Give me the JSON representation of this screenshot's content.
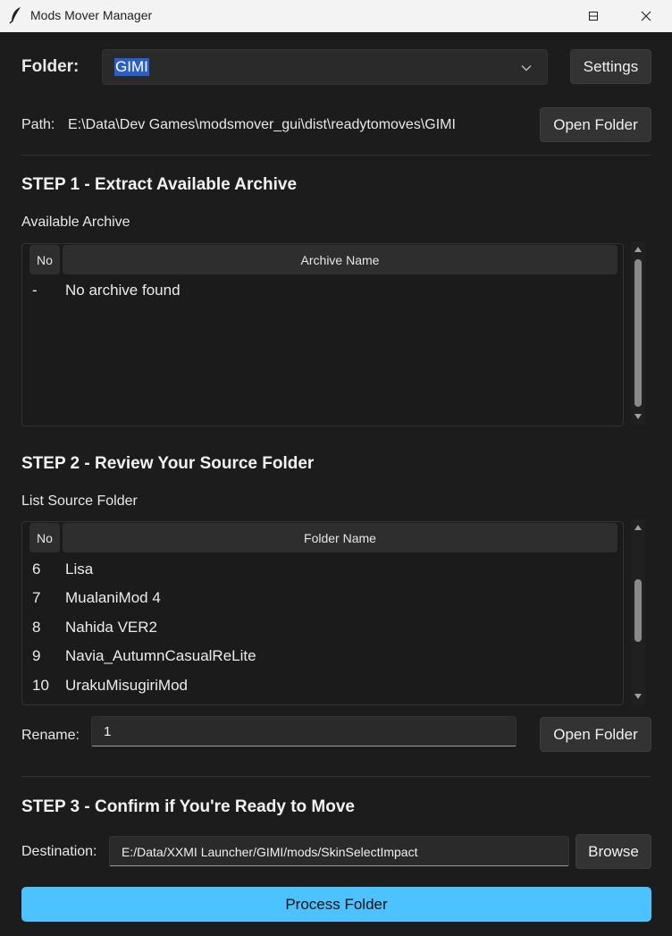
{
  "window": {
    "title": "Mods Mover Manager"
  },
  "folder": {
    "label": "Folder:",
    "selected": "GIMI",
    "settings_label": "Settings"
  },
  "path": {
    "label": "Path:",
    "value": "E:\\Data\\Dev Games\\modsmover_gui\\dist\\readytomoves\\GIMI",
    "open_label": "Open Folder"
  },
  "step1": {
    "title": "STEP 1 - Extract Available Archive",
    "list_label": "Available Archive",
    "columns": [
      "No",
      "Archive Name"
    ],
    "rows": [
      {
        "no": "-",
        "name": "No archive found"
      }
    ]
  },
  "step2": {
    "title": "STEP 2 - Review Your Source Folder",
    "list_label": "List Source Folder",
    "columns": [
      "No",
      "Folder Name"
    ],
    "rows": [
      {
        "no": "6",
        "name": "Lisa"
      },
      {
        "no": "7",
        "name": "MualaniMod 4"
      },
      {
        "no": "8",
        "name": "Nahida VER2"
      },
      {
        "no": "9",
        "name": "Navia_AutumnCasualReLite"
      },
      {
        "no": "10",
        "name": "UrakuMisugiriMod"
      }
    ],
    "rename_label": "Rename:",
    "rename_value": "1",
    "open_label": "Open Folder"
  },
  "step3": {
    "title": "STEP 3 - Confirm if You're Ready to Move",
    "destination_label": "Destination:",
    "destination_value": "E:/Data/XXMI Launcher/GIMI/mods/SkinSelectImpact",
    "browse_label": "Browse",
    "process_label": "Process Folder"
  },
  "colors": {
    "accent": "#4cc2ff",
    "background": "#1c1c1c",
    "selection": "#2a5fc7"
  },
  "icons": {
    "app": "feather-icon",
    "minimize": "minimize-icon",
    "maximize": "maximize-icon",
    "close": "close-icon",
    "dropdown": "chevron-down-icon"
  }
}
